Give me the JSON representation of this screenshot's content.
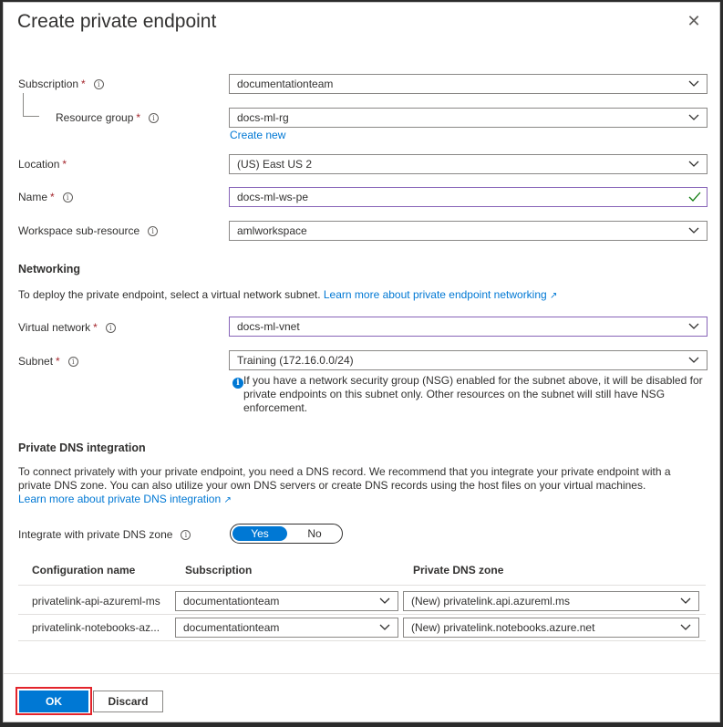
{
  "dialog": {
    "title": "Create private endpoint",
    "close_icon": "close-icon"
  },
  "form": {
    "subscription": {
      "label": "Subscription",
      "required": "*",
      "value": "documentationteam"
    },
    "resource_group": {
      "label": "Resource group",
      "required": "*",
      "value": "docs-ml-rg",
      "create_new": "Create new"
    },
    "location": {
      "label": "Location",
      "required": "*",
      "value": "(US) East US 2"
    },
    "name": {
      "label": "Name",
      "required": "*",
      "value": "docs-ml-ws-pe"
    },
    "sub_resource": {
      "label": "Workspace sub-resource",
      "value": "amlworkspace"
    }
  },
  "networking": {
    "heading": "Networking",
    "description": "To deploy the private endpoint, select a virtual network subnet.",
    "learn_more": "Learn more about private endpoint networking",
    "virtual_network": {
      "label": "Virtual network",
      "required": "*",
      "value": "docs-ml-vnet"
    },
    "subnet": {
      "label": "Subnet",
      "required": "*",
      "value": "Training (172.16.0.0/24)"
    },
    "nsg_note_line1": "If you have a network security group (NSG) enabled for the subnet above, it will be disabled for",
    "nsg_note_line2": "private endpoints on this subnet only. Other resources on the subnet will still have NSG",
    "nsg_note_line3": "enforcement."
  },
  "dns": {
    "heading": "Private DNS integration",
    "description_line1": "To connect privately with your private endpoint, you need a DNS record. We recommend that you integrate your private endpoint with a",
    "description_line2": "private DNS zone. You can also utilize your own DNS servers or create DNS records using the host files on your virtual machines.",
    "learn_more": "Learn more about private DNS integration",
    "integrate_label": "Integrate with private DNS zone",
    "toggle_yes": "Yes",
    "toggle_no": "No",
    "toggle_value": "Yes",
    "table": {
      "headers": [
        "Configuration name",
        "Subscription",
        "Private DNS zone"
      ],
      "rows": [
        {
          "name": "privatelink-api-azureml-ms",
          "subscription": "documentationteam",
          "zone": "(New) privatelink.api.azureml.ms"
        },
        {
          "name": "privatelink-notebooks-az...",
          "subscription": "documentationteam",
          "zone": "(New) privatelink.notebooks.azure.net"
        }
      ]
    }
  },
  "footer": {
    "ok_label": "OK",
    "discard_label": "Discard"
  },
  "colors": {
    "accent": "#0078d4",
    "required": "#a4262c",
    "highlight_box": "#e3242b",
    "valid_check": "#107c10"
  }
}
